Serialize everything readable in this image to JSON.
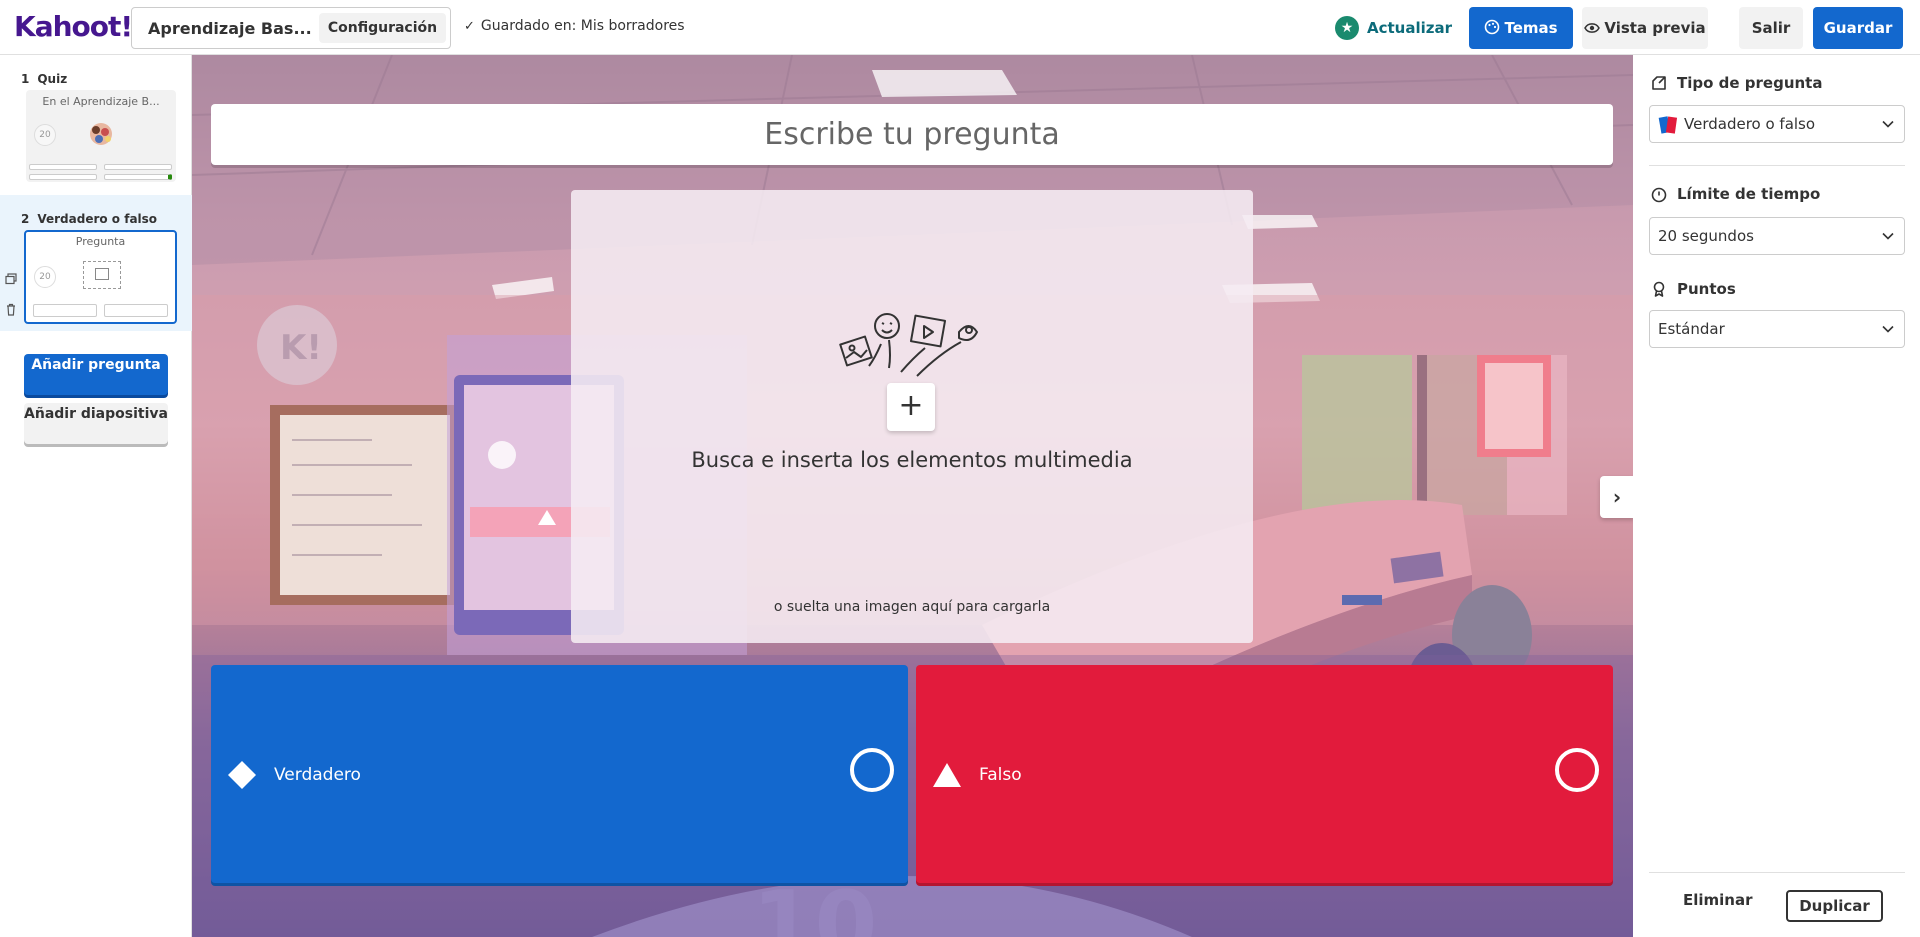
{
  "app": {
    "logo": "Kahoot!",
    "kahoot_title": "Aprendizaje Bas...",
    "settings_label": "Configuración",
    "saved_status": "Guardado en: Mis borradores",
    "upgrade_label": "Actualizar",
    "themes_label": "Temas",
    "preview_label": "Vista previa",
    "exit_label": "Salir",
    "save_label": "Guardar"
  },
  "sidebar": {
    "slides": [
      {
        "number": "1",
        "type": "Quiz",
        "title": "En el Aprendizaje B...",
        "timer": "20"
      },
      {
        "number": "2",
        "type": "Verdadero o falso",
        "title": "Pregunta",
        "timer": "20"
      }
    ],
    "add_question": "Añadir pregunta",
    "add_slide": "Añadir diapositiva"
  },
  "editor": {
    "question_placeholder": "Escribe tu pregunta",
    "media_title": "Busca e inserta los elementos multimedia",
    "media_subtitle": "o suelta una imagen aquí para cargarla",
    "answers": [
      {
        "label": "Verdadero",
        "shape": "diamond",
        "color": "#1368ce"
      },
      {
        "label": "Falso",
        "shape": "triangle",
        "color": "#e21b3c"
      }
    ]
  },
  "panel": {
    "question_type_label": "Tipo de pregunta",
    "question_type_value": "Verdadero o falso",
    "time_limit_label": "Límite de tiempo",
    "time_limit_value": "20 segundos",
    "points_label": "Puntos",
    "points_value": "Estándar",
    "delete_label": "Eliminar",
    "duplicate_label": "Duplicar"
  },
  "colors": {
    "brand": "#46178f",
    "primary": "#1368ce",
    "red": "#e21b3c",
    "upgrade": "#0c6b7a"
  }
}
